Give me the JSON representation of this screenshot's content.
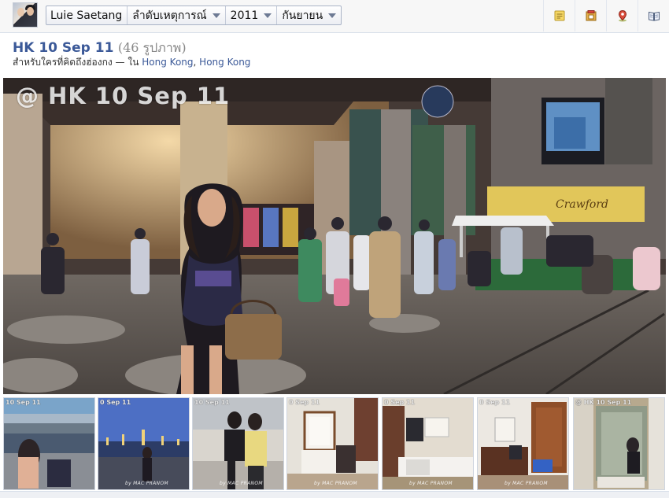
{
  "header": {
    "user_name": "Luie Saetang",
    "timeline_label": "ลำดับเหตุการณ์",
    "year": "2011",
    "month": "กันยายน"
  },
  "toolbar_icons": [
    "note-icon",
    "timeline-box-icon",
    "location-pin-icon",
    "book-icon"
  ],
  "album": {
    "title": "HK 10 Sep 11",
    "count": "(46 รูปภาพ)",
    "subtitle_prefix": "สำหรับใครที่คิดถึงฮ่องกง — ใน",
    "location_city": "Hong Kong",
    "location_sep": ",",
    "location_region": "Hong Kong"
  },
  "main_photo": {
    "watermark": "@ HK 10 Sep 11",
    "billboard_text": "Crawford"
  },
  "thumbnails": [
    {
      "watermark": "10 Sep 11",
      "credit": ""
    },
    {
      "watermark": "0 Sep 11",
      "credit": "by MAC PRANOM"
    },
    {
      "watermark": "10 Sep 11",
      "credit": "by MAC PRANOM"
    },
    {
      "watermark": "0 Sep 11",
      "credit": "by MAC PRANOM"
    },
    {
      "watermark": "0 Sep 11",
      "credit": "by MAC PRANOM"
    },
    {
      "watermark": "0 Sep 11",
      "credit": "by MAC PRANOM"
    },
    {
      "watermark": "@ HK 10 Sep 11",
      "credit": ""
    }
  ],
  "colors": {
    "link": "#3b5998",
    "topbar": "#f7f7f7",
    "border": "#d8dfea"
  }
}
